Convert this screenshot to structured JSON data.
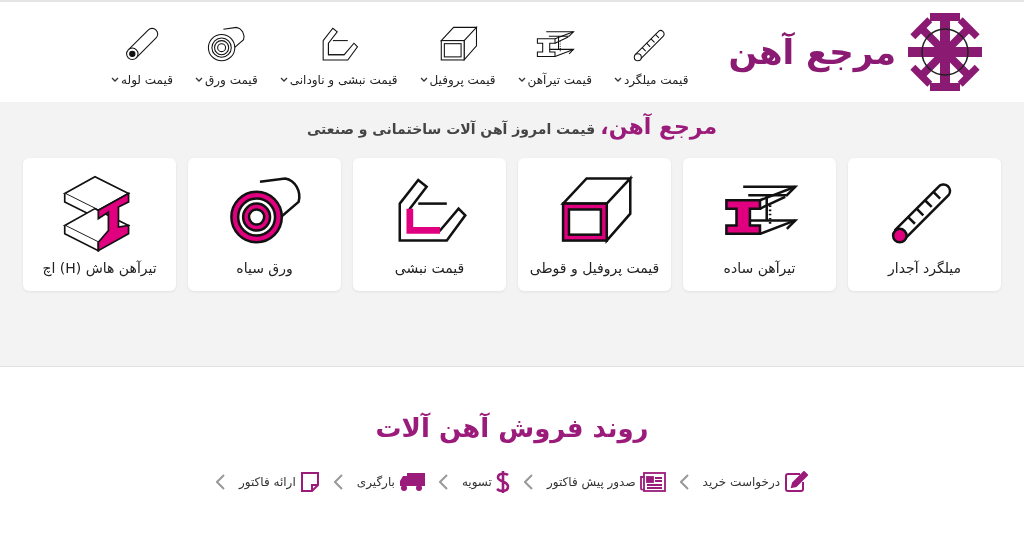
{
  "logo": {
    "text": "مرجع آهن"
  },
  "nav": [
    {
      "label": "قیمت میلگرد",
      "kind": "rebar"
    },
    {
      "label": "قیمت تیرآهن",
      "kind": "ibeam"
    },
    {
      "label": "قیمت پروفیل",
      "kind": "profile"
    },
    {
      "label": "قیمت نبشی و ناودانی",
      "kind": "angle"
    },
    {
      "label": "قیمت ورق",
      "kind": "sheet"
    },
    {
      "label": "قیمت لوله",
      "kind": "pipe"
    }
  ],
  "headline": {
    "brand": "مرجع آهن،",
    "tagline": "قیمت امروز آهن آلات ساختمانی و صنعتی"
  },
  "cards": [
    {
      "label": "میلگرد آجدار",
      "kind": "rebar"
    },
    {
      "label": "تیرآهن ساده",
      "kind": "ibeam"
    },
    {
      "label": "قیمت پروفیل و قوطی",
      "kind": "profile"
    },
    {
      "label": "قیمت نبشی",
      "kind": "angle"
    },
    {
      "label": "ورق سیاه",
      "kind": "sheet"
    },
    {
      "label": "تیرآهن هاش (H) اچ",
      "kind": "hbeam"
    }
  ],
  "process": {
    "title": "روند فروش آهن آلات",
    "steps": [
      {
        "label": "درخواست خرید",
        "kind": "edit"
      },
      {
        "label": "صدور پیش فاکتور",
        "kind": "invoice"
      },
      {
        "label": "تسویه",
        "kind": "dollar"
      },
      {
        "label": "بارگیری",
        "kind": "truck"
      },
      {
        "label": "ارائه فاکتور",
        "kind": "note"
      }
    ]
  }
}
